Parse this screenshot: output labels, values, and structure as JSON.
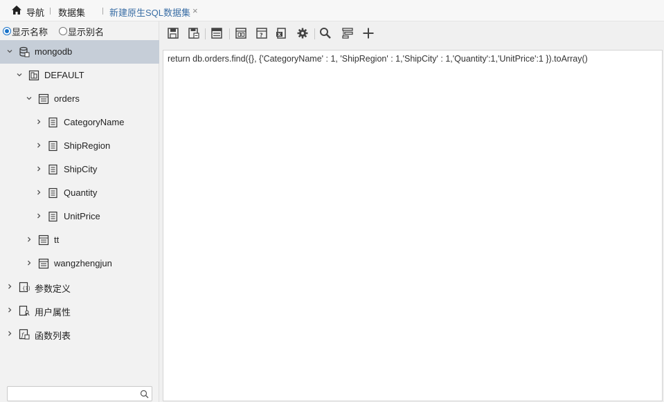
{
  "topbar": {
    "nav_label": "导航",
    "dataset_label": "数据集",
    "active_tab_label": "新建原生SQL数据集",
    "close_label": "×"
  },
  "display_mode": {
    "show_name_label": "显示名称",
    "show_alias_label": "显示别名",
    "selected": "show_name"
  },
  "tree": {
    "root": {
      "label": "mongodb",
      "icon": "database-icon",
      "expanded": true,
      "selected": true
    },
    "schema": {
      "label": "DEFAULT",
      "icon": "schema-icon",
      "expanded": true
    },
    "tables": [
      {
        "label": "orders",
        "icon": "table-icon",
        "expanded": true,
        "fields": [
          "CategoryName",
          "ShipRegion",
          "ShipCity",
          "Quantity",
          "UnitPrice"
        ]
      },
      {
        "label": "tt",
        "icon": "table-icon",
        "expanded": false
      },
      {
        "label": "wangzhengjun",
        "icon": "table-icon",
        "expanded": false
      }
    ],
    "sections": [
      {
        "label": "参数定义",
        "icon": "parameter-icon"
      },
      {
        "label": "用户属性",
        "icon": "user-property-icon"
      },
      {
        "label": "函数列表",
        "icon": "function-list-icon"
      }
    ]
  },
  "search": {
    "placeholder": "",
    "icon": "search-icon"
  },
  "toolbar": {
    "buttons": [
      "save-icon",
      "save-as-icon",
      "preview-icon",
      "layout-icon",
      "help-icon",
      "excel-icon",
      "settings-icon",
      "search-icon",
      "filter-settings-icon",
      "add-icon"
    ]
  },
  "editor": {
    "code": "return db.orders.find({}, {'CategoryName' : 1, 'ShipRegion' : 1,'ShipCity' : 1,'Quantity':1,'UnitPrice':1 }).toArray()"
  },
  "colors": {
    "selected_row": "#c6ced8",
    "active_tab_text": "#3a6ea5",
    "radio_accent": "#1a73c8"
  }
}
